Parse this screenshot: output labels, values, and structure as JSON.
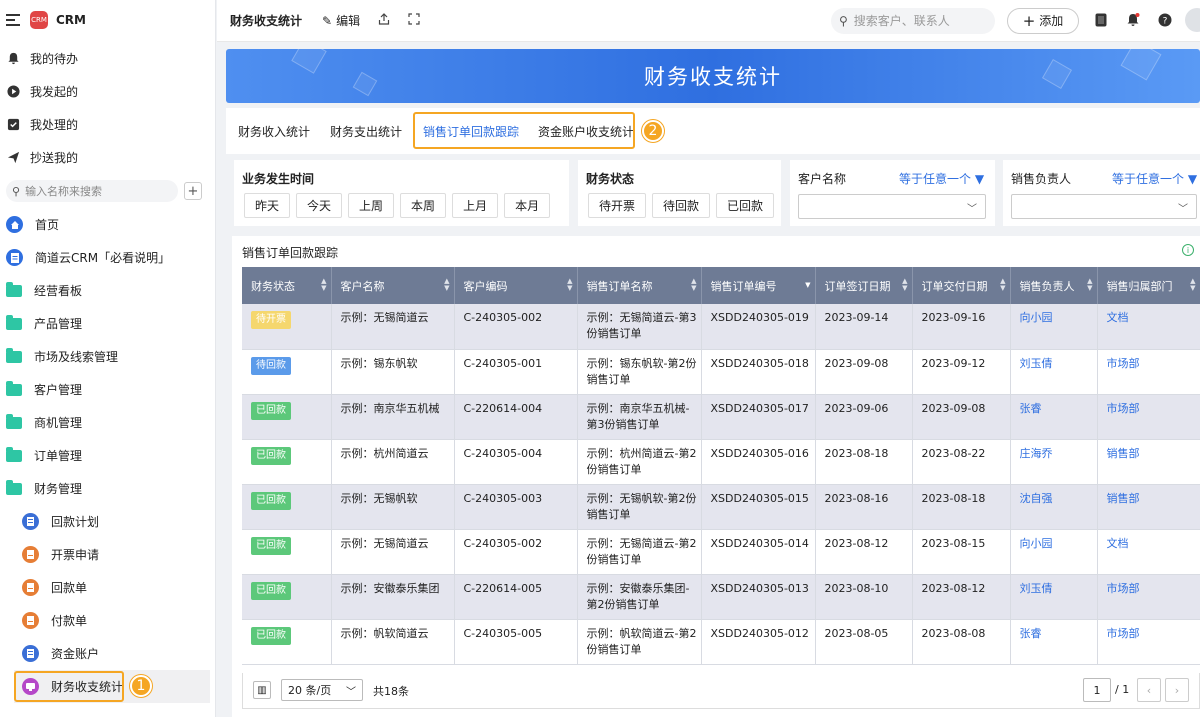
{
  "app": {
    "name": "CRM",
    "logo_text": "CRM"
  },
  "sidebar": {
    "quick": [
      {
        "label": "我的待办",
        "icon": "bell-icon"
      },
      {
        "label": "我发起的",
        "icon": "play-circle-icon"
      },
      {
        "label": "我处理的",
        "icon": "checkbox-icon"
      },
      {
        "label": "抄送我的",
        "icon": "send-icon"
      }
    ],
    "search_placeholder": "输入名称来搜索",
    "nav": [
      {
        "label": "首页",
        "icon": "home-icon"
      },
      {
        "label": "简道云CRM「必看说明」",
        "icon": "doc-icon"
      },
      {
        "label": "经营看板",
        "icon": "folder-icon"
      },
      {
        "label": "产品管理",
        "icon": "folder-icon"
      },
      {
        "label": "市场及线索管理",
        "icon": "folder-icon"
      },
      {
        "label": "客户管理",
        "icon": "folder-icon"
      },
      {
        "label": "商机管理",
        "icon": "folder-icon"
      },
      {
        "label": "订单管理",
        "icon": "folder-icon"
      },
      {
        "label": "财务管理",
        "icon": "folder-open-icon"
      }
    ],
    "sub": [
      {
        "label": "回款计划",
        "color": "#3b6fd6"
      },
      {
        "label": "开票申请",
        "color": "#e67e36"
      },
      {
        "label": "回款单",
        "color": "#e67e36"
      },
      {
        "label": "付款单",
        "color": "#e67e36"
      },
      {
        "label": "资金账户",
        "color": "#3b6fd6"
      },
      {
        "label": "财务收支统计",
        "color": "#b547c8"
      }
    ],
    "marker": "1"
  },
  "topbar": {
    "title": "财务收支统计",
    "edit_label": "编辑",
    "search_placeholder": "搜索客户、联系人",
    "add_label": "添加"
  },
  "banner": {
    "title": "财务收支统计"
  },
  "tabs": {
    "items": [
      "财务收入统计",
      "财务支出统计",
      "销售订单回款跟踪",
      "资金账户收支统计"
    ],
    "active": 2,
    "marker": "2"
  },
  "filters": {
    "date": {
      "label": "业务发生时间",
      "options": [
        "昨天",
        "今天",
        "上周",
        "本周",
        "上月",
        "本月"
      ]
    },
    "status": {
      "label": "财务状态",
      "options": [
        "待开票",
        "待回款",
        "已回款"
      ]
    },
    "customer": {
      "label": "客户名称",
      "mode": "等于任意一个"
    },
    "owner": {
      "label": "销售负责人",
      "mode": "等于任意一个"
    }
  },
  "table": {
    "title": "销售订单回款跟踪",
    "columns": [
      "财务状态",
      "客户名称",
      "客户编码",
      "销售订单名称",
      "销售订单编号",
      "订单签订日期",
      "订单交付日期",
      "销售负责人",
      "销售归属部门"
    ],
    "status_colors": {
      "待开票": "#f5d76e",
      "待回款": "#5b9bea",
      "已回款": "#5cc87a"
    },
    "rows": [
      {
        "status": "待开票",
        "customer": "示例：无锡简道云",
        "code": "C-240305-002",
        "order": "示例：无锡简道云-第3份销售订单",
        "order_no": "XSDD240305-019",
        "sign": "2023-09-14",
        "deliver": "2023-09-16",
        "owner": "向小园",
        "dept": "文档"
      },
      {
        "status": "待回款",
        "customer": "示例：锡东帆软",
        "code": "C-240305-001",
        "order": "示例：锡东帆软-第2份销售订单",
        "order_no": "XSDD240305-018",
        "sign": "2023-09-08",
        "deliver": "2023-09-12",
        "owner": "刘玉倩",
        "dept": "市场部"
      },
      {
        "status": "已回款",
        "customer": "示例：南京华五机械",
        "code": "C-220614-004",
        "order": "示例：南京华五机械-第3份销售订单",
        "order_no": "XSDD240305-017",
        "sign": "2023-09-06",
        "deliver": "2023-09-08",
        "owner": "张睿",
        "dept": "市场部"
      },
      {
        "status": "已回款",
        "customer": "示例：杭州简道云",
        "code": "C-240305-004",
        "order": "示例：杭州简道云-第2份销售订单",
        "order_no": "XSDD240305-016",
        "sign": "2023-08-18",
        "deliver": "2023-08-22",
        "owner": "庄海乔",
        "dept": "销售部"
      },
      {
        "status": "已回款",
        "customer": "示例：无锡帆软",
        "code": "C-240305-003",
        "order": "示例：无锡帆软-第2份销售订单",
        "order_no": "XSDD240305-015",
        "sign": "2023-08-16",
        "deliver": "2023-08-18",
        "owner": "沈自强",
        "dept": "销售部"
      },
      {
        "status": "已回款",
        "customer": "示例：无锡简道云",
        "code": "C-240305-002",
        "order": "示例：无锡简道云-第2份销售订单",
        "order_no": "XSDD240305-014",
        "sign": "2023-08-12",
        "deliver": "2023-08-15",
        "owner": "向小园",
        "dept": "文档"
      },
      {
        "status": "已回款",
        "customer": "示例：安徽泰乐集团",
        "code": "C-220614-005",
        "order": "示例：安徽泰乐集团-第2份销售订单",
        "order_no": "XSDD240305-013",
        "sign": "2023-08-10",
        "deliver": "2023-08-12",
        "owner": "刘玉倩",
        "dept": "市场部"
      },
      {
        "status": "已回款",
        "customer": "示例：帆软简道云",
        "code": "C-240305-005",
        "order": "示例：帆软简道云-第2份销售订单",
        "order_no": "XSDD240305-012",
        "sign": "2023-08-05",
        "deliver": "2023-08-08",
        "owner": "张睿",
        "dept": "市场部"
      }
    ]
  },
  "pager": {
    "page_size": "20 条/页",
    "total": "共18条",
    "page": "1",
    "of": "/ 1"
  }
}
